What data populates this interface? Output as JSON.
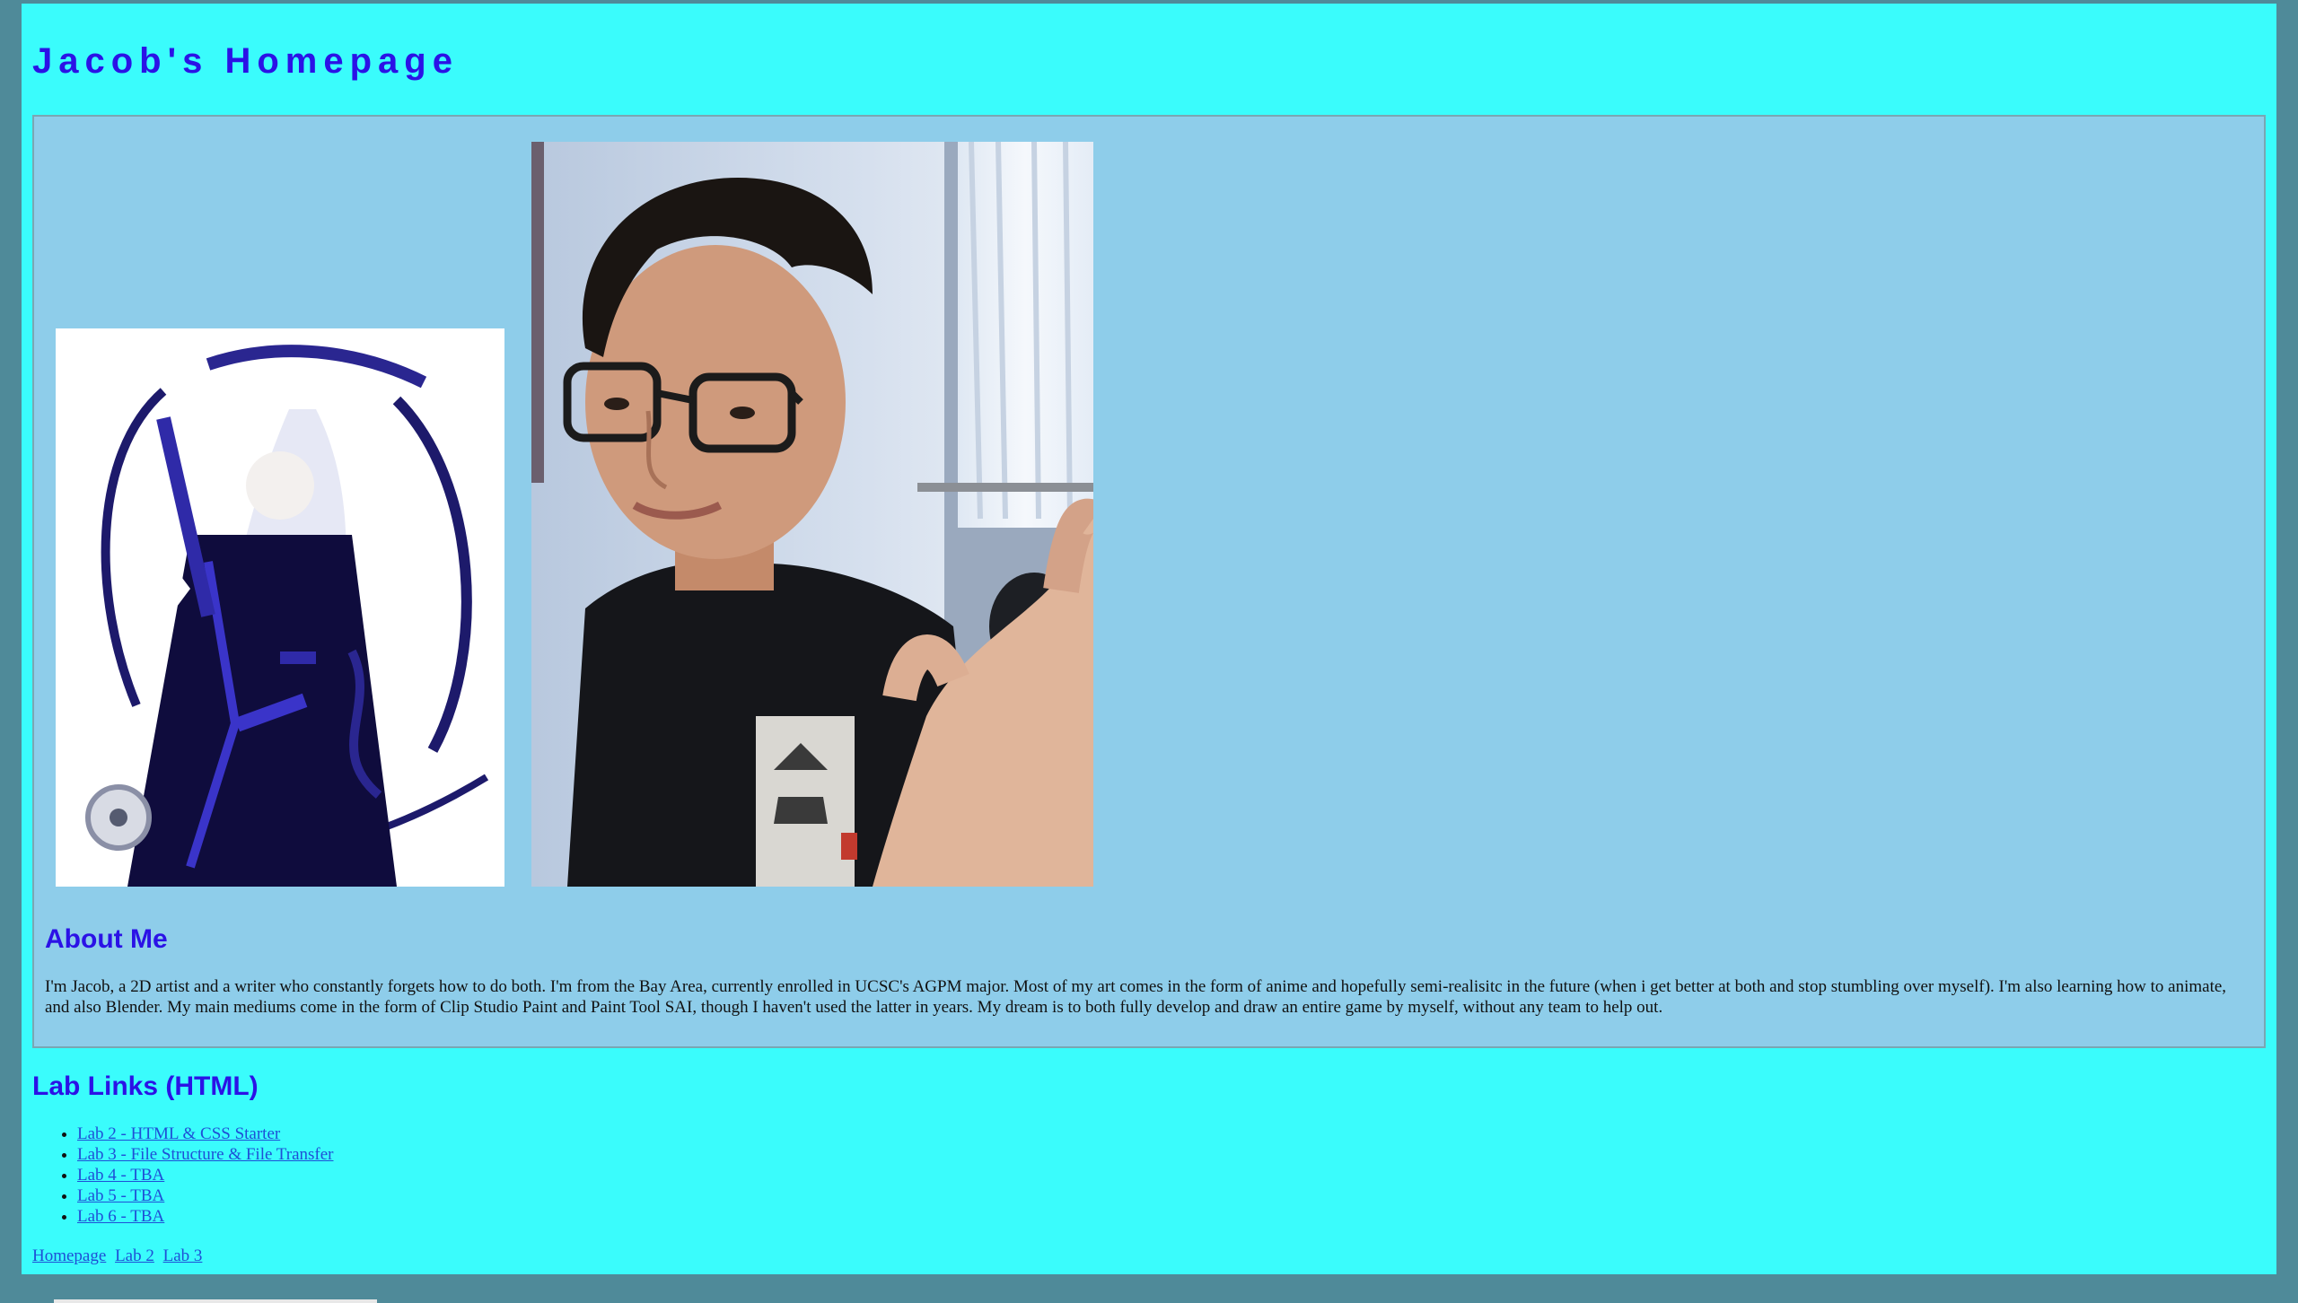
{
  "header": {
    "title": "Jacob's Homepage"
  },
  "gallery": {
    "art_image": "anime-character-artwork",
    "photo_image": "selfie-photo"
  },
  "about": {
    "heading": "About Me",
    "text": "I'm Jacob, a 2D artist and a writer who constantly forgets how to do both. I'm from the Bay Area, currently enrolled in UCSC's AGPM major. Most of my art comes in the form of anime and hopefully semi-realisitc in the future (when i get better at both and stop stumbling over myself). I'm also learning how to animate, and also Blender. My main mediums come in the form of Clip Studio Paint and Paint Tool SAI, though I haven't used the latter in years. My dream is to both fully develop and draw an entire game by myself, without any team to help out."
  },
  "labs": {
    "heading": "Lab Links (HTML)",
    "items": [
      "Lab 2 - HTML & CSS Starter",
      "Lab 3 - File Structure & File Transfer",
      "Lab 4 - TBA",
      "Lab 5 - TBA",
      "Lab 6 - TBA"
    ]
  },
  "footer": {
    "links": [
      "Homepage",
      "Lab 2",
      "Lab 3"
    ]
  },
  "colors": {
    "page_background": "#3afcfc",
    "panel_background": "#8ecdea",
    "heading": "#2b12e6",
    "outer_background": "#4f8a99"
  }
}
